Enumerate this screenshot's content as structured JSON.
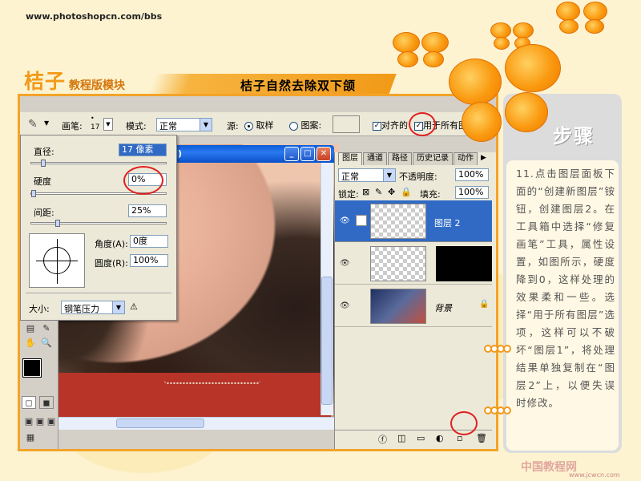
{
  "site_url": "www.photoshopcn.com/bbs",
  "brand": {
    "logo": "桔子",
    "subtitle": "教程版模块"
  },
  "tutorial_title": "桔子自然去除双下颌",
  "options_bar": {
    "brush_label": "画笔:",
    "brush_size": "17",
    "mode_label": "模式:",
    "mode_value": "正常",
    "source_label": "源:",
    "sampled_label": "取样",
    "pattern_label": "图案:",
    "aligned_label": "对齐的",
    "use_all_layers_label": "用于所有图层"
  },
  "brush_popup": {
    "diameter_label": "直径:",
    "diameter_value": "17 像素",
    "hardness_label": "硬度",
    "hardness_value": "0%",
    "spacing_label": "间距:",
    "spacing_value": "25%",
    "angle_label": "角度(A):",
    "angle_value": "0度",
    "roundness_label": "圆度(R):",
    "roundness_value": "100%",
    "size_label": "大小:",
    "size_value": "钢笔压力"
  },
  "doc_window": {
    "title_fragment": "))"
  },
  "layers_panel": {
    "tabs": [
      "图层",
      "通道",
      "路径",
      "历史记录",
      "动作"
    ],
    "blend_mode": "正常",
    "opacity_label": "不透明度:",
    "opacity_value": "100%",
    "lock_label": "锁定:",
    "fill_label": "填充:",
    "fill_value": "100%",
    "layers": [
      {
        "name": "图层 2",
        "selected": true
      },
      {
        "name": "",
        "selected": false
      },
      {
        "name": "背景",
        "selected": false
      }
    ]
  },
  "steps_panel": {
    "heading": "步骤",
    "text": "11.点击图层面板下面的“创建新图层”铵钮，创建图层2。在工具箱中选择“修复画笔”工具，属性设置，如图所示，硬度降到0，这样处理的效果柔和一些。选择“用于所有图层”选项，这样可以不破坏“图层1”，将处理结果单独复制在“图层2”上，以便失误时修改。"
  },
  "footer": {
    "brand": "中国教程网",
    "url": "www.jcwcn.com"
  },
  "colors": {
    "accent_orange": "#f29a18",
    "highlight_red": "#e02020",
    "selection_blue": "#316ac5"
  }
}
